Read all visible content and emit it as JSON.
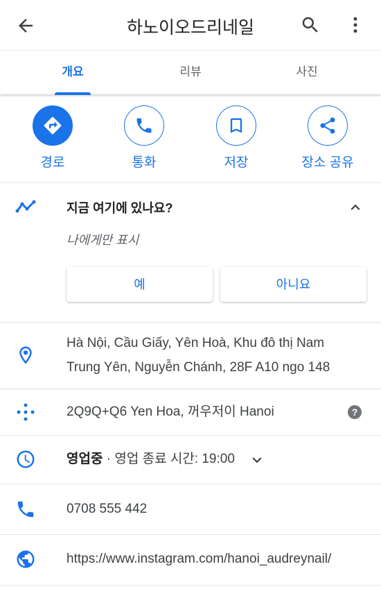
{
  "header": {
    "title": "하노이오드리네일"
  },
  "tabs": [
    {
      "label": "개요",
      "active": true
    },
    {
      "label": "리뷰",
      "active": false
    },
    {
      "label": "사진",
      "active": false
    }
  ],
  "actions": [
    {
      "label": "경로",
      "icon": "directions-icon"
    },
    {
      "label": "통화",
      "icon": "phone-icon"
    },
    {
      "label": "저장",
      "icon": "bookmark-icon"
    },
    {
      "label": "장소 공유",
      "icon": "share-icon"
    }
  ],
  "here_prompt": {
    "question": "지금 여기에 있나요?",
    "subtitle": "나에게만 표시",
    "yes_label": "예",
    "no_label": "아니요"
  },
  "details": {
    "address_line1": "Hà Nội, Cầu Giấy, Yên Hoà, Khu đô thị Nam",
    "address_line2": "Trung Yên, Nguyễn Chánh, 28F A10 ngo 148",
    "plus_code": "2Q9Q+Q6 Yen Hoa, 꺼우저이 Hanoi",
    "help_glyph": "?",
    "hours_status": "영업중",
    "hours_separator": " · ",
    "hours_detail": "영업 종료 시간: 19:00",
    "phone": "0708 555 442",
    "website": "https://www.instagram.com/hanoi_audreynail/"
  },
  "colors": {
    "accent": "#1a73e8",
    "text": "#202124",
    "secondary": "#5f6368"
  }
}
